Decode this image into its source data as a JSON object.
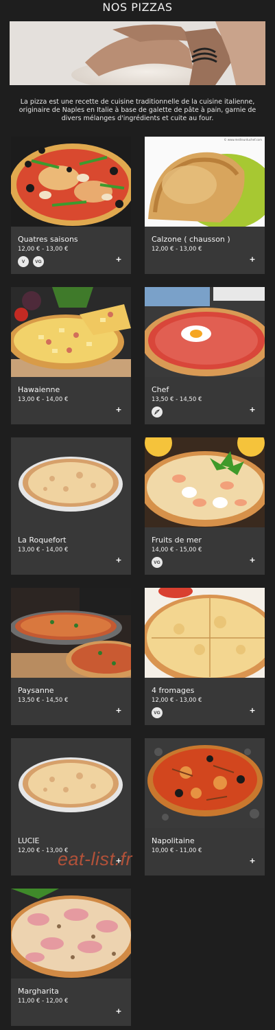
{
  "page": {
    "title": "NOS PIZZAS",
    "intro": "La pizza est une recette de cuisine traditionnelle de la cuisine italienne, originaire de Naples en Italie à base de galette de pâte à pain, garnie de divers mélanges d'ingrédients et cuite au four.",
    "watermark": "eat-list.fr",
    "image_credit": "© www.meilleurduchef.com"
  },
  "theme": {
    "background": "#1e1e1e",
    "card": "#383838",
    "text": "#ffffff",
    "badge": "#e9e9e9"
  },
  "pizzas": [
    {
      "name": "Quatres saisons",
      "price": "12,00 € - 13,00 €",
      "badges": [
        "V",
        "VG"
      ],
      "add": "+"
    },
    {
      "name": "Calzone ( chausson )",
      "price": "12,00 € - 13,00 €",
      "badges": [],
      "add": "+"
    },
    {
      "name": "Hawaienne",
      "price": "13,00 € - 14,00 €",
      "badges": [],
      "add": "+"
    },
    {
      "name": "Chef",
      "price": "13,50 € - 14,50 €",
      "badges": [
        "spicy-icon"
      ],
      "add": "+"
    },
    {
      "name": "La Roquefort",
      "price": "13,00 € - 14,00 €",
      "badges": [],
      "add": "+"
    },
    {
      "name": "Fruits de mer",
      "price": "14,00 € - 15,00 €",
      "badges": [
        "VG"
      ],
      "add": "+"
    },
    {
      "name": "Paysanne",
      "price": "13,50 € - 14,50 €",
      "badges": [],
      "add": "+"
    },
    {
      "name": "4 fromages",
      "price": "12,00 € - 13,00 €",
      "badges": [
        "VG"
      ],
      "add": "+"
    },
    {
      "name": "LUCIE",
      "price": "12,00 € - 13,00 €",
      "badges": [],
      "add": "+"
    },
    {
      "name": "Napolitaine",
      "price": "10,00 € - 11,00 €",
      "badges": [],
      "add": "+"
    },
    {
      "name": "Margharita",
      "price": "11,00 € - 12,00 €",
      "badges": [],
      "add": "+"
    }
  ]
}
